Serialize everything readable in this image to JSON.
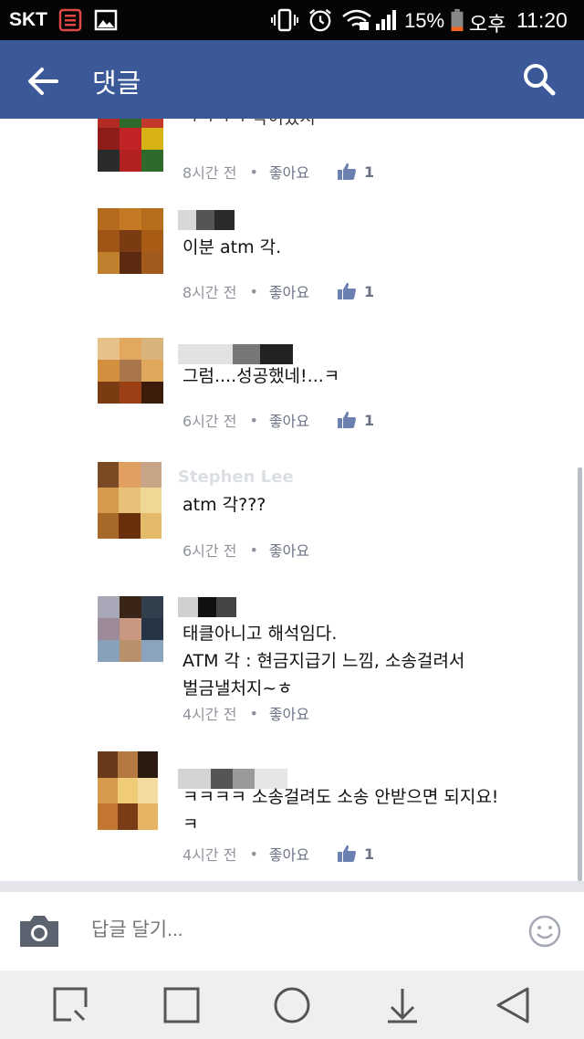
{
  "status_bar": {
    "carrier": "SKT",
    "battery_pct": "15%",
    "ampm": "오후",
    "time": "11:20"
  },
  "app_bar": {
    "title": "댓글"
  },
  "comments": [
    {
      "author": "",
      "text": "ㅋㅋㅋㅋ 각이겠지",
      "time": "8시간 전",
      "like_label": "좋아요",
      "likes": "1"
    },
    {
      "author": "",
      "text": "이분 atm 각.",
      "time": "8시간 전",
      "like_label": "좋아요",
      "likes": "1"
    },
    {
      "author": "",
      "text": "그럼....성공했네!...ㅋ",
      "time": "6시간 전",
      "like_label": "좋아요",
      "likes": "1"
    },
    {
      "author": "Stephen Lee",
      "text": "atm 각???",
      "time": "6시간 전",
      "like_label": "좋아요",
      "likes": ""
    },
    {
      "author": "",
      "text": "태클아니고 해석임다.\nATM 각 : 현금지급기 느낌, 소송걸려서\n벌금낼처지~ㅎ",
      "time": "4시간 전",
      "like_label": "좋아요",
      "likes": ""
    },
    {
      "author": "",
      "text": "ㅋㅋㅋㅋ 소송걸려도 소송 안받으면 되지요!\nㅋ",
      "time": "4시간 전",
      "like_label": "좋아요",
      "likes": "1"
    }
  ],
  "reply_bar": {
    "placeholder": "답글 달기..."
  },
  "colors": {
    "brand": "#3b5998",
    "meta_gray": "#90949c",
    "status_bar": "#050505"
  },
  "icons": {
    "back": "arrow-left-icon",
    "search": "search-icon",
    "like": "thumbs-up-icon",
    "camera": "camera-icon",
    "emoji": "smiley-icon",
    "nav_recents": "recent-apps-icon",
    "nav_overview": "square-icon",
    "nav_home": "home-circle-icon",
    "nav_down": "download-icon",
    "nav_back": "back-triangle-icon"
  }
}
